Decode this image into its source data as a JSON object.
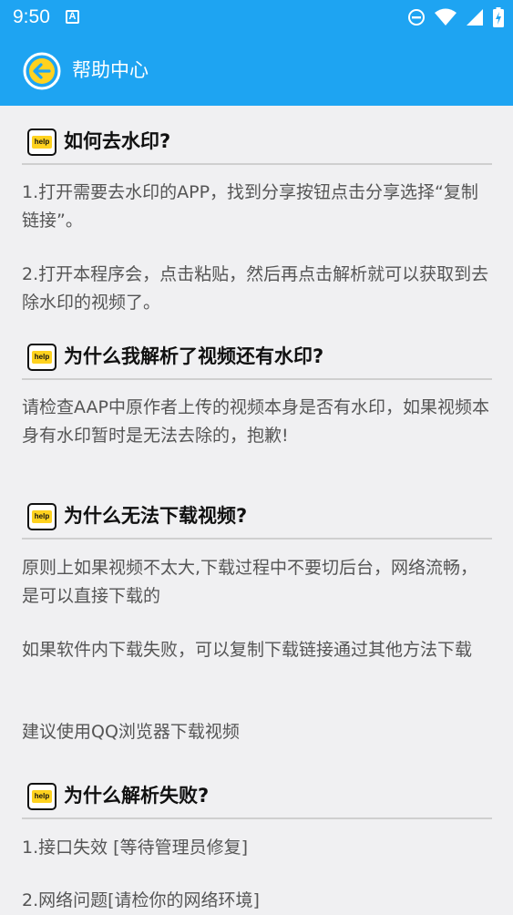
{
  "status": {
    "time": "9:50",
    "notification_letter": "A"
  },
  "appbar": {
    "title": "帮助中心"
  },
  "sections": [
    {
      "title": "如何去水印?",
      "paragraphs": [
        "1.打开需要去水印的APP，找到分享按钮点击分享选择“复制链接”。",
        "2.打开本程序会，点击粘贴，然后再点击解析就可以获取到去除水印的视频了。"
      ]
    },
    {
      "title": "为什么我解析了视频还有水印?",
      "paragraphs": [
        "请检查AAP中原作者上传的视频本身是否有水印，如果视频本身有水印暂时是无法去除的，抱歉!"
      ]
    },
    {
      "title": "为什么无法下载视频?",
      "paragraphs": [
        "原则上如果视频不太大,下载过程中不要切后台，网络流畅，是可以直接下载的",
        "如果软件内下载失败，可以复制下载链接通过其他方法下载",
        "建议使用QQ浏览器下载视频"
      ]
    },
    {
      "title": "为什么解析失败?",
      "paragraphs": [
        "1.接口失效 [等待管理员修复]",
        "2.网络问题[请检你的网络环境]"
      ]
    }
  ],
  "help_badge_label": "help",
  "icons": [
    "back-arrow-icon",
    "do-not-disturb-icon",
    "wifi-icon",
    "signal-icon",
    "battery-icon",
    "help-icon"
  ],
  "colors": {
    "primary": "#1ea4f2",
    "badge_yellow": "#ffd21f",
    "background": "#f0f0f2"
  }
}
